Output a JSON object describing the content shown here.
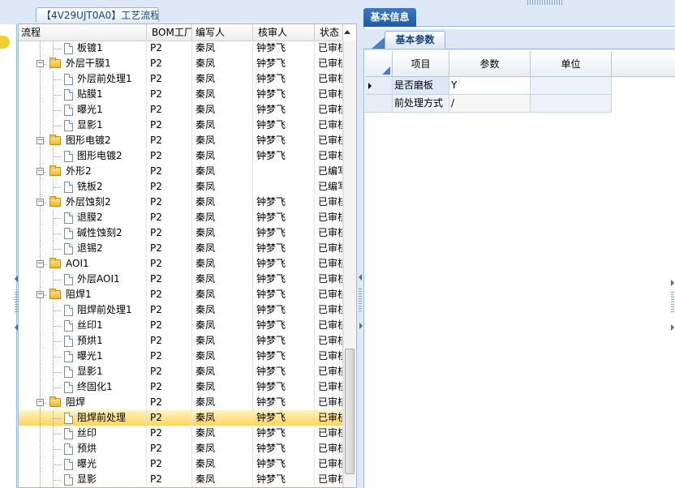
{
  "tree_tab": {
    "label": "【4V29UJT0A0】工艺流程"
  },
  "tree_columns": [
    "流程",
    "BOM工厂",
    "编写人",
    "核审人",
    "状态"
  ],
  "tree_rows": [
    {
      "name": "板镀1",
      "type": "doc",
      "bom": "P2",
      "writer": "秦凤",
      "auditor": "钟梦飞",
      "status": "已审核"
    },
    {
      "name": "外层干膜1",
      "type": "folder",
      "bom": "P2",
      "writer": "秦凤",
      "auditor": "钟梦飞",
      "status": "已审核"
    },
    {
      "name": "外层前处理1",
      "type": "doc",
      "bom": "P2",
      "writer": "秦凤",
      "auditor": "钟梦飞",
      "status": "已审核"
    },
    {
      "name": "贴膜1",
      "type": "doc",
      "bom": "P2",
      "writer": "秦凤",
      "auditor": "钟梦飞",
      "status": "已审核"
    },
    {
      "name": "曝光1",
      "type": "doc",
      "bom": "P2",
      "writer": "秦凤",
      "auditor": "钟梦飞",
      "status": "已审核"
    },
    {
      "name": "显影1",
      "type": "doc",
      "bom": "P2",
      "writer": "秦凤",
      "auditor": "钟梦飞",
      "status": "已审核"
    },
    {
      "name": "图形电镀2",
      "type": "folder",
      "bom": "P2",
      "writer": "秦凤",
      "auditor": "钟梦飞",
      "status": "已审核"
    },
    {
      "name": "图形电镀2",
      "type": "doc",
      "bom": "P2",
      "writer": "秦凤",
      "auditor": "钟梦飞",
      "status": "已审核"
    },
    {
      "name": "外形2",
      "type": "folder",
      "bom": "P2",
      "writer": "秦凤",
      "auditor": "",
      "status": "已编写"
    },
    {
      "name": "铣板2",
      "type": "doc",
      "bom": "P2",
      "writer": "秦凤",
      "auditor": "",
      "status": "已编写"
    },
    {
      "name": "外层蚀刻2",
      "type": "folder",
      "bom": "P2",
      "writer": "秦凤",
      "auditor": "钟梦飞",
      "status": "已审核"
    },
    {
      "name": "退膜2",
      "type": "doc",
      "bom": "P2",
      "writer": "秦凤",
      "auditor": "钟梦飞",
      "status": "已审核"
    },
    {
      "name": "碱性蚀刻2",
      "type": "doc",
      "bom": "P2",
      "writer": "秦凤",
      "auditor": "钟梦飞",
      "status": "已审核"
    },
    {
      "name": "退锡2",
      "type": "doc",
      "bom": "P2",
      "writer": "秦凤",
      "auditor": "钟梦飞",
      "status": "已审核"
    },
    {
      "name": "AOI1",
      "type": "folder",
      "bom": "P2",
      "writer": "秦凤",
      "auditor": "钟梦飞",
      "status": "已审核"
    },
    {
      "name": "外层AOI1",
      "type": "doc",
      "bom": "P2",
      "writer": "秦凤",
      "auditor": "钟梦飞",
      "status": "已审核"
    },
    {
      "name": "阻焊1",
      "type": "folder",
      "bom": "P2",
      "writer": "秦凤",
      "auditor": "钟梦飞",
      "status": "已审核"
    },
    {
      "name": "阻焊前处理1",
      "type": "doc",
      "bom": "P2",
      "writer": "秦凤",
      "auditor": "钟梦飞",
      "status": "已审核"
    },
    {
      "name": "丝印1",
      "type": "doc",
      "bom": "P2",
      "writer": "秦凤",
      "auditor": "钟梦飞",
      "status": "已审核"
    },
    {
      "name": "预烘1",
      "type": "doc",
      "bom": "P2",
      "writer": "秦凤",
      "auditor": "钟梦飞",
      "status": "已审核"
    },
    {
      "name": "曝光1",
      "type": "doc",
      "bom": "P2",
      "writer": "秦凤",
      "auditor": "钟梦飞",
      "status": "已审核"
    },
    {
      "name": "显影1",
      "type": "doc",
      "bom": "P2",
      "writer": "秦凤",
      "auditor": "钟梦飞",
      "status": "已审核"
    },
    {
      "name": "终固化1",
      "type": "doc",
      "bom": "P2",
      "writer": "秦凤",
      "auditor": "钟梦飞",
      "status": "已审核"
    },
    {
      "name": "阻焊",
      "type": "folder",
      "bom": "P2",
      "writer": "秦凤",
      "auditor": "钟梦飞",
      "status": "已审核"
    },
    {
      "name": "阻焊前处理",
      "type": "doc",
      "bom": "P2",
      "writer": "秦凤",
      "auditor": "钟梦飞",
      "status": "已审核",
      "selected": true
    },
    {
      "name": "丝印",
      "type": "doc",
      "bom": "P2",
      "writer": "秦凤",
      "auditor": "钟梦飞",
      "status": "已审核"
    },
    {
      "name": "预烘",
      "type": "doc",
      "bom": "P2",
      "writer": "秦凤",
      "auditor": "钟梦飞",
      "status": "已审核"
    },
    {
      "name": "曝光",
      "type": "doc",
      "bom": "P2",
      "writer": "秦凤",
      "auditor": "钟梦飞",
      "status": "已审核"
    },
    {
      "name": "显影",
      "type": "doc",
      "bom": "P2",
      "writer": "秦凤",
      "auditor": "钟梦飞",
      "status": "已审核"
    }
  ],
  "right_panel": {
    "tab_label": "基本信息",
    "sub_tab_label": "基本参数",
    "grid_columns": [
      "项目",
      "参数",
      "单位"
    ],
    "grid_rows": [
      {
        "item": "是否磨板",
        "param": "Y",
        "unit": "",
        "current": true
      },
      {
        "item": "前处理方式",
        "param": "/",
        "unit": "",
        "current": false
      }
    ]
  },
  "colors": {
    "selection": "#ffd45e",
    "tab_active": "#1f5aa3",
    "frame": "#dfe8f6",
    "border": "#99bbe8"
  }
}
